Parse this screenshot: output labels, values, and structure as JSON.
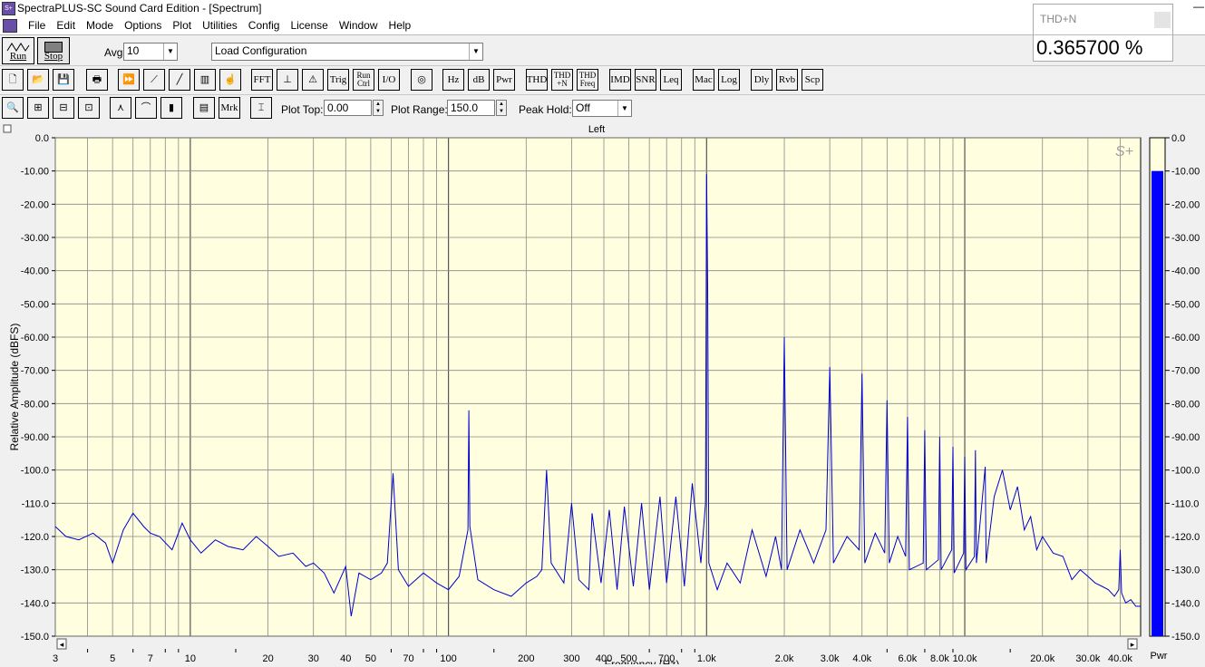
{
  "window": {
    "title": "SpectraPLUS-SC Sound Card Edition - [Spectrum]"
  },
  "menu": [
    "File",
    "Edit",
    "Mode",
    "Options",
    "Plot",
    "Utilities",
    "Config",
    "License",
    "Window",
    "Help"
  ],
  "toolbar1": {
    "run_label": "Run",
    "stop_label": "Stop",
    "avg_label": "Avg",
    "avg_value": "10",
    "config_value": "Load Configuration"
  },
  "toolbar2": {
    "fft": "FFT",
    "trig": "Trig",
    "run_ctrl_1": "Run",
    "run_ctrl_2": "Ctrl",
    "io": "I/O",
    "hz": "Hz",
    "db": "dB",
    "pwr": "Pwr",
    "thd": "THD",
    "thdn_1": "THD",
    "thdn_2": "+N",
    "thdf_1": "THD",
    "thdf_2": "Freq",
    "imd": "IMD",
    "snr": "SNR",
    "leq": "Leq",
    "mac": "Mac",
    "log": "Log",
    "dly": "Dly",
    "rvb": "Rvb",
    "scp": "Scp"
  },
  "toolbar3": {
    "mrk": "Mrk",
    "plot_top_label": "Plot Top:",
    "plot_top_value": "0.00",
    "plot_range_label": "Plot Range:",
    "plot_range_value": "150.0",
    "peak_hold_label": "Peak Hold:",
    "peak_hold_value": "Off"
  },
  "thd_window": {
    "title": "THD+N",
    "value": "0.365700 %"
  },
  "plot": {
    "channel_label": "Left",
    "logo": "S+",
    "meter_label": "Pwr",
    "colors": {
      "background": "#ffffe0",
      "trace": "#0000cc",
      "meter": "#0000ff"
    }
  },
  "chart_data": {
    "type": "line",
    "title": "Left",
    "xlabel": "Frequency (Hz)",
    "ylabel": "Relative Amplitude (dBFS)",
    "x_scale": "log",
    "xlim": [
      3,
      48000
    ],
    "ylim": [
      -150,
      0
    ],
    "grid": true,
    "y_ticks": [
      "0.0",
      "-10.00",
      "-20.00",
      "-30.00",
      "-40.00",
      "-50.00",
      "-60.00",
      "-70.00",
      "-80.00",
      "-90.00",
      "-100.0",
      "-110.0",
      "-120.0",
      "-130.0",
      "-140.0",
      "-150.0"
    ],
    "x_ticks": [
      {
        "v": 3,
        "l": "3"
      },
      {
        "v": 5,
        "l": "5"
      },
      {
        "v": 7,
        "l": "7"
      },
      {
        "v": 10,
        "l": "10"
      },
      {
        "v": 20,
        "l": "20"
      },
      {
        "v": 30,
        "l": "30"
      },
      {
        "v": 40,
        "l": "40"
      },
      {
        "v": 50,
        "l": "50"
      },
      {
        "v": 70,
        "l": "70"
      },
      {
        "v": 100,
        "l": "100"
      },
      {
        "v": 200,
        "l": "200"
      },
      {
        "v": 300,
        "l": "300"
      },
      {
        "v": 400,
        "l": "400"
      },
      {
        "v": 500,
        "l": "500"
      },
      {
        "v": 700,
        "l": "700"
      },
      {
        "v": 1000,
        "l": "1.0k"
      },
      {
        "v": 2000,
        "l": "2.0k"
      },
      {
        "v": 3000,
        "l": "3.0k"
      },
      {
        "v": 4000,
        "l": "4.0k"
      },
      {
        "v": 6000,
        "l": "6.0k"
      },
      {
        "v": 8000,
        "l": "8.0k"
      },
      {
        "v": 10000,
        "l": "10.0k"
      },
      {
        "v": 20000,
        "l": "20.0k"
      },
      {
        "v": 30000,
        "l": "30.0k"
      },
      {
        "v": 40000,
        "l": "40.0k"
      }
    ],
    "series": [
      {
        "points": [
          [
            3,
            -117
          ],
          [
            3.3,
            -120
          ],
          [
            3.7,
            -121
          ],
          [
            4.2,
            -119
          ],
          [
            4.7,
            -122
          ],
          [
            5,
            -128
          ],
          [
            5.5,
            -118
          ],
          [
            6,
            -113
          ],
          [
            6.6,
            -117
          ],
          [
            7,
            -119
          ],
          [
            7.6,
            -120
          ],
          [
            8.5,
            -124
          ],
          [
            9.3,
            -116
          ],
          [
            10,
            -121
          ],
          [
            11,
            -125
          ],
          [
            12.5,
            -121
          ],
          [
            14,
            -123
          ],
          [
            16,
            -124
          ],
          [
            18,
            -120
          ],
          [
            20,
            -123
          ],
          [
            22,
            -126
          ],
          [
            25,
            -125
          ],
          [
            28,
            -129
          ],
          [
            30,
            -128
          ],
          [
            33,
            -131
          ],
          [
            36,
            -137
          ],
          [
            40,
            -129
          ],
          [
            42,
            -144
          ],
          [
            45,
            -131
          ],
          [
            50,
            -133
          ],
          [
            55,
            -131
          ],
          [
            58,
            -128
          ],
          [
            61,
            -101
          ],
          [
            64,
            -130
          ],
          [
            70,
            -135
          ],
          [
            80,
            -131
          ],
          [
            90,
            -134
          ],
          [
            100,
            -136
          ],
          [
            110,
            -132
          ],
          [
            119,
            -118
          ],
          [
            120,
            -82
          ],
          [
            121,
            -117
          ],
          [
            130,
            -133
          ],
          [
            150,
            -136
          ],
          [
            175,
            -138
          ],
          [
            200,
            -134
          ],
          [
            220,
            -132
          ],
          [
            230,
            -130
          ],
          [
            240,
            -100
          ],
          [
            250,
            -128
          ],
          [
            280,
            -134
          ],
          [
            300,
            -110
          ],
          [
            320,
            -133
          ],
          [
            350,
            -136
          ],
          [
            360,
            -113
          ],
          [
            390,
            -134
          ],
          [
            420,
            -112
          ],
          [
            450,
            -136
          ],
          [
            480,
            -111
          ],
          [
            520,
            -135
          ],
          [
            560,
            -110
          ],
          [
            600,
            -136
          ],
          [
            660,
            -108
          ],
          [
            700,
            -134
          ],
          [
            760,
            -108
          ],
          [
            820,
            -135
          ],
          [
            880,
            -104
          ],
          [
            950,
            -128
          ],
          [
            990,
            -110
          ],
          [
            1000,
            -11
          ],
          [
            1010,
            -45
          ],
          [
            1020,
            -128
          ],
          [
            1100,
            -136
          ],
          [
            1200,
            -128
          ],
          [
            1350,
            -134
          ],
          [
            1500,
            -118
          ],
          [
            1700,
            -132
          ],
          [
            1850,
            -120
          ],
          [
            1950,
            -130
          ],
          [
            2000,
            -60
          ],
          [
            2050,
            -130
          ],
          [
            2300,
            -118
          ],
          [
            2600,
            -128
          ],
          [
            2900,
            -118
          ],
          [
            3000,
            -69
          ],
          [
            3100,
            -128
          ],
          [
            3500,
            -120
          ],
          [
            3900,
            -124
          ],
          [
            4000,
            -71
          ],
          [
            4100,
            -128
          ],
          [
            4500,
            -119
          ],
          [
            4900,
            -125
          ],
          [
            5000,
            -79
          ],
          [
            5100,
            -128
          ],
          [
            5500,
            -120
          ],
          [
            5900,
            -126
          ],
          [
            6000,
            -84
          ],
          [
            6100,
            -130
          ],
          [
            6900,
            -128
          ],
          [
            7000,
            -88
          ],
          [
            7100,
            -130
          ],
          [
            7900,
            -127
          ],
          [
            8000,
            -90
          ],
          [
            8100,
            -130
          ],
          [
            8900,
            -124
          ],
          [
            9000,
            -93
          ],
          [
            9100,
            -131
          ],
          [
            9900,
            -125
          ],
          [
            10000,
            -96
          ],
          [
            10100,
            -130
          ],
          [
            10900,
            -126
          ],
          [
            11000,
            -94
          ],
          [
            11100,
            -128
          ],
          [
            12000,
            -99
          ],
          [
            12100,
            -128
          ],
          [
            13000,
            -108
          ],
          [
            14000,
            -100
          ],
          [
            15000,
            -112
          ],
          [
            16000,
            -105
          ],
          [
            17000,
            -118
          ],
          [
            18000,
            -114
          ],
          [
            19000,
            -124
          ],
          [
            20000,
            -120
          ],
          [
            22000,
            -125
          ],
          [
            24000,
            -126
          ],
          [
            26000,
            -133
          ],
          [
            28000,
            -130
          ],
          [
            30000,
            -132
          ],
          [
            32000,
            -134
          ],
          [
            34000,
            -135
          ],
          [
            36000,
            -136
          ],
          [
            38000,
            -138
          ],
          [
            39500,
            -136
          ],
          [
            40000,
            -124
          ],
          [
            40500,
            -137
          ],
          [
            42000,
            -140
          ],
          [
            44000,
            -139
          ],
          [
            46000,
            -141
          ],
          [
            48000,
            -141
          ]
        ]
      }
    ],
    "meter": {
      "label": "Pwr",
      "value": -10,
      "ylim": [
        -150,
        0
      ]
    }
  }
}
